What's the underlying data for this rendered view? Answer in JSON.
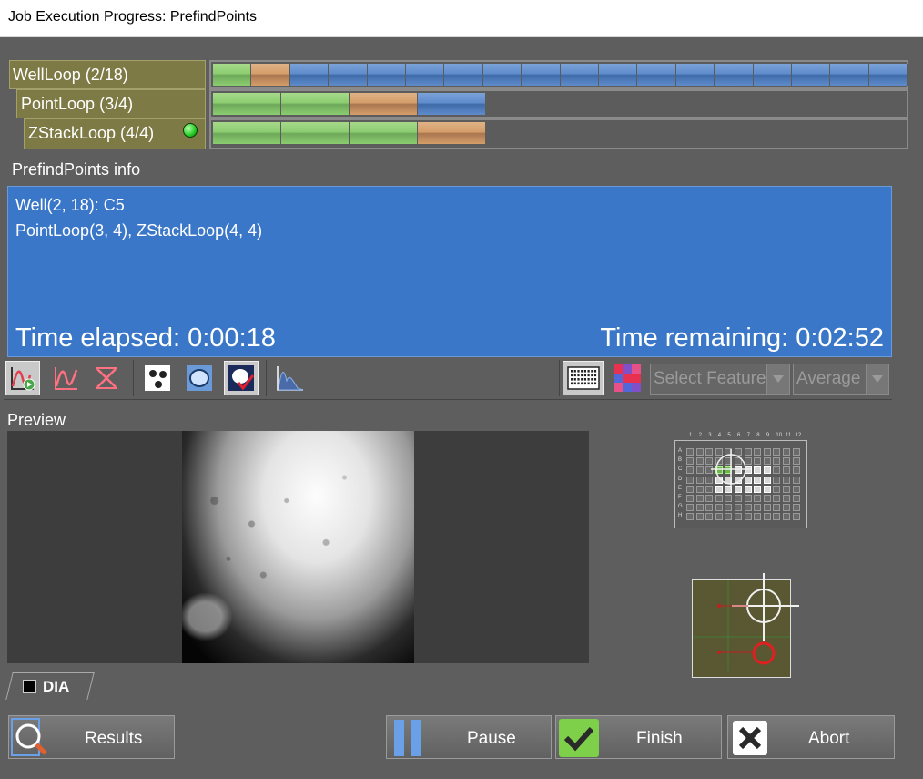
{
  "window": {
    "title": "Job Execution Progress: PrefindPoints"
  },
  "loops": [
    {
      "label": "WellLoop (2/18)",
      "done": 1,
      "current": 1,
      "total": 18
    },
    {
      "label": "PointLoop (3/4)",
      "done": 2,
      "current": 1,
      "total": 4
    },
    {
      "label": "ZStackLoop (4/4)",
      "done": 3,
      "current": 1,
      "total": 4
    }
  ],
  "info": {
    "title": "PrefindPoints info",
    "line1": "Well(2, 18): C5",
    "line2": "PointLoop(3, 4), ZStackLoop(4, 4)",
    "elapsed": "Time elapsed: 0:00:18",
    "remaining": "Time remaining: 0:02:52"
  },
  "toolbar": {
    "select_feature": "Select Feature",
    "average": "Average"
  },
  "preview": {
    "title": "Preview",
    "channel": "DIA"
  },
  "plate": {
    "col_labels": [
      "1",
      "2",
      "3",
      "4",
      "5",
      "6",
      "7",
      "8",
      "9",
      "10",
      "11",
      "12"
    ],
    "row_labels": [
      "A",
      "B",
      "C",
      "D",
      "E",
      "F",
      "G",
      "H"
    ]
  },
  "buttons": {
    "results": "Results",
    "pause": "Pause",
    "finish": "Finish",
    "abort": "Abort"
  },
  "colors": {
    "done": "#8ccd70",
    "current": "#d59e6a",
    "pending": "#5f8ccc",
    "info_bg": "#3a77c8",
    "loop_bg": "#7d7a45"
  }
}
